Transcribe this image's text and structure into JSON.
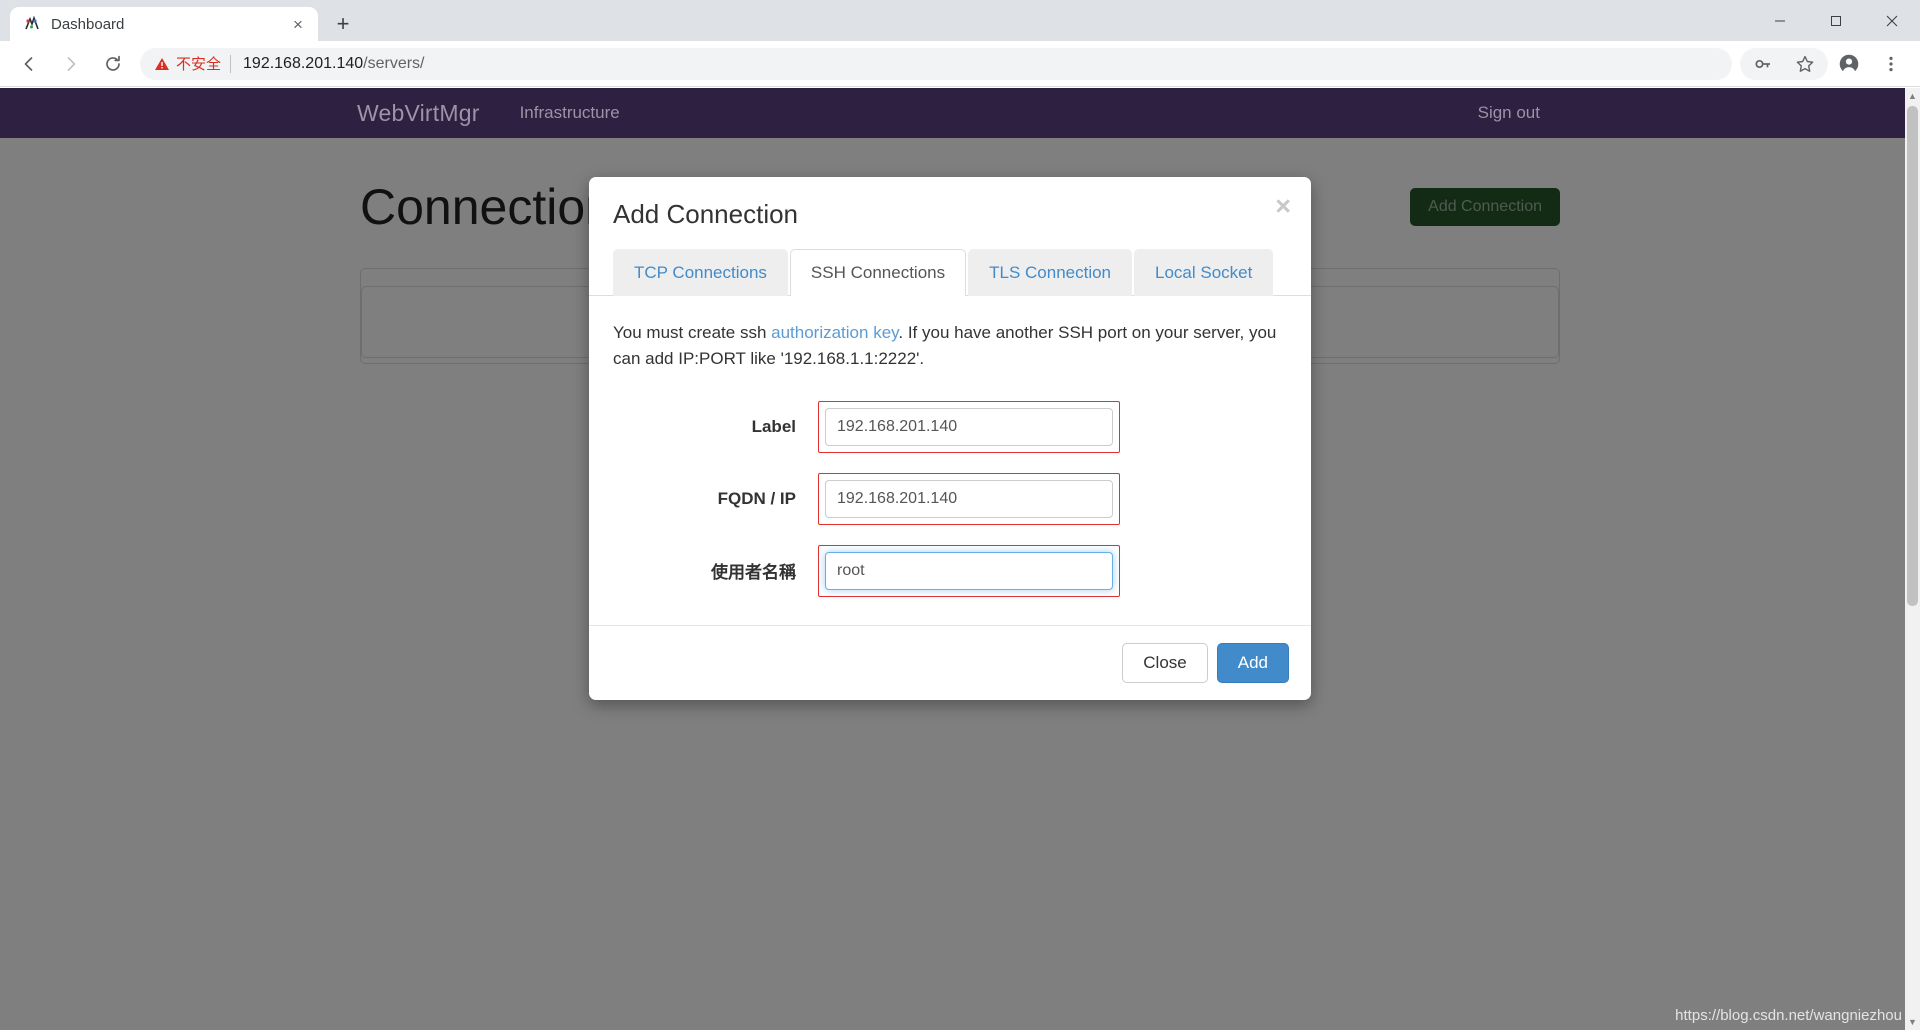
{
  "browser": {
    "tab": {
      "title": "Dashboard",
      "favicon": "webvirtmgr-favicon",
      "close": "×"
    },
    "new_tab_label": "+",
    "window_controls": {
      "minimize": "─",
      "maximize": "☐",
      "close": "✕"
    },
    "nav": {
      "back": "←",
      "forward": "→",
      "reload": "⟳"
    },
    "omnibox": {
      "security_warning": "不安全",
      "url_host": "192.168.201.140",
      "url_path": "/servers/"
    },
    "toolbar_icons": [
      "key-icon",
      "star-icon",
      "profile-avatar-icon",
      "more-menu-icon"
    ],
    "status_bar_url": "https://blog.csdn.net/wangniezhou"
  },
  "app": {
    "navbar": {
      "brand": "WebVirtMgr",
      "links": [
        "Infrastructure"
      ],
      "sign_out": "Sign out"
    },
    "page": {
      "title": "Connections",
      "add_connection_button": "Add Connection"
    }
  },
  "modal": {
    "title": "Add Connection",
    "close_symbol": "×",
    "tabs": [
      {
        "label": "TCP Connections",
        "active": false
      },
      {
        "label": "SSH Connections",
        "active": true
      },
      {
        "label": "TLS Connection",
        "active": false
      },
      {
        "label": "Local Socket",
        "active": false
      }
    ],
    "help": {
      "prefix": "You must create ssh ",
      "link": "authorization key",
      "suffix": ". If you have another SSH port on your server, you can add IP:PORT like '192.168.1.1:2222'."
    },
    "fields": [
      {
        "label": "Label",
        "value": "192.168.201.140",
        "focused": false
      },
      {
        "label": "FQDN / IP",
        "value": "192.168.201.140",
        "focused": false
      },
      {
        "label": "使用者名稱",
        "value": "root",
        "focused": true
      }
    ],
    "footer": {
      "close_button": "Close",
      "add_button": "Add"
    }
  },
  "colors": {
    "navbar_bg": "#2d2040",
    "primary_button": "#428bca",
    "add_connection_green": "#265429",
    "tab_link": "#428bca",
    "validation_border": "#e03030",
    "warning_red": "#d93025"
  }
}
